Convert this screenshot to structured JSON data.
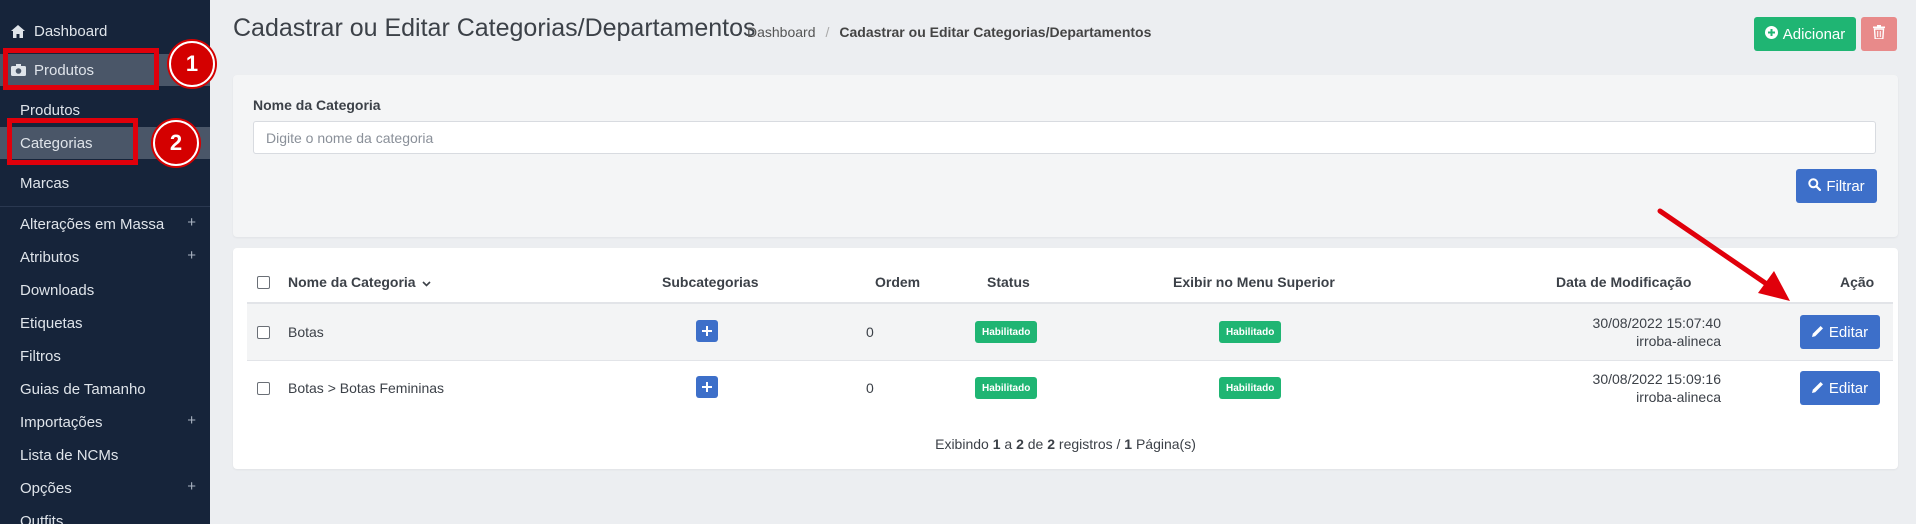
{
  "sidebar": {
    "dashboard": "Dashboard",
    "produtos_group": "Produtos",
    "items": [
      {
        "label": "Produtos",
        "plus": ""
      },
      {
        "label": "Categorias",
        "plus": ""
      },
      {
        "label": "Marcas",
        "plus": ""
      },
      {
        "label": "Alterações em Massa",
        "plus": "+"
      },
      {
        "label": "Atributos",
        "plus": "+"
      },
      {
        "label": "Downloads",
        "plus": ""
      },
      {
        "label": "Etiquetas",
        "plus": ""
      },
      {
        "label": "Filtros",
        "plus": ""
      },
      {
        "label": "Guias de Tamanho",
        "plus": ""
      },
      {
        "label": "Importações",
        "plus": "+"
      },
      {
        "label": "Lista de NCMs",
        "plus": ""
      },
      {
        "label": "Opções",
        "plus": "+"
      },
      {
        "label": "Outfits",
        "plus": ""
      }
    ]
  },
  "annotations": {
    "one": "1",
    "two": "2"
  },
  "header": {
    "title": "Cadastrar ou Editar Categorias/Departamentos",
    "breadcrumb": [
      "Dashboard",
      "Cadastrar ou Editar Categorias/Departamentos"
    ],
    "breadcrumb_sep": "/",
    "add_label": "Adicionar"
  },
  "filter": {
    "label": "Nome da Categoria",
    "placeholder": "Digite o nome da categoria",
    "button": "Filtrar"
  },
  "table": {
    "headers": {
      "name": "Nome da Categoria",
      "sub": "Subcategorias",
      "order": "Ordem",
      "status": "Status",
      "menu": "Exibir no Menu Superior",
      "date": "Data de Modificação",
      "action": "Ação"
    },
    "rows": [
      {
        "name": "Botas",
        "order": "0",
        "status": "Habilitado",
        "menu": "Habilitado",
        "date": "30/08/2022 15:07:40",
        "user": "irroba-alineca",
        "action": "Editar"
      },
      {
        "name": "Botas  >  Botas Femininas",
        "order": "0",
        "status": "Habilitado",
        "menu": "Habilitado",
        "date": "30/08/2022 15:09:16",
        "user": "irroba-alineca",
        "action": "Editar"
      }
    ],
    "pager": {
      "prefix": "Exibindo",
      "from": "1",
      "a": "a",
      "to": "2",
      "de": "de",
      "total": "2",
      "registros": "registros /",
      "pages": "1",
      "suffix": "Página(s)"
    }
  },
  "colors": {
    "sidebar": "#16243a",
    "primary": "#3d6fc9",
    "success": "#1fb573",
    "danger": "#e88a8a",
    "annotation": "#e0000b"
  },
  "icons": {
    "dashboard": "home-icon",
    "produtos": "camera-icon",
    "add": "plus-circle-icon",
    "delete": "trash-icon",
    "filter": "search-icon",
    "edit": "pencil-icon"
  }
}
